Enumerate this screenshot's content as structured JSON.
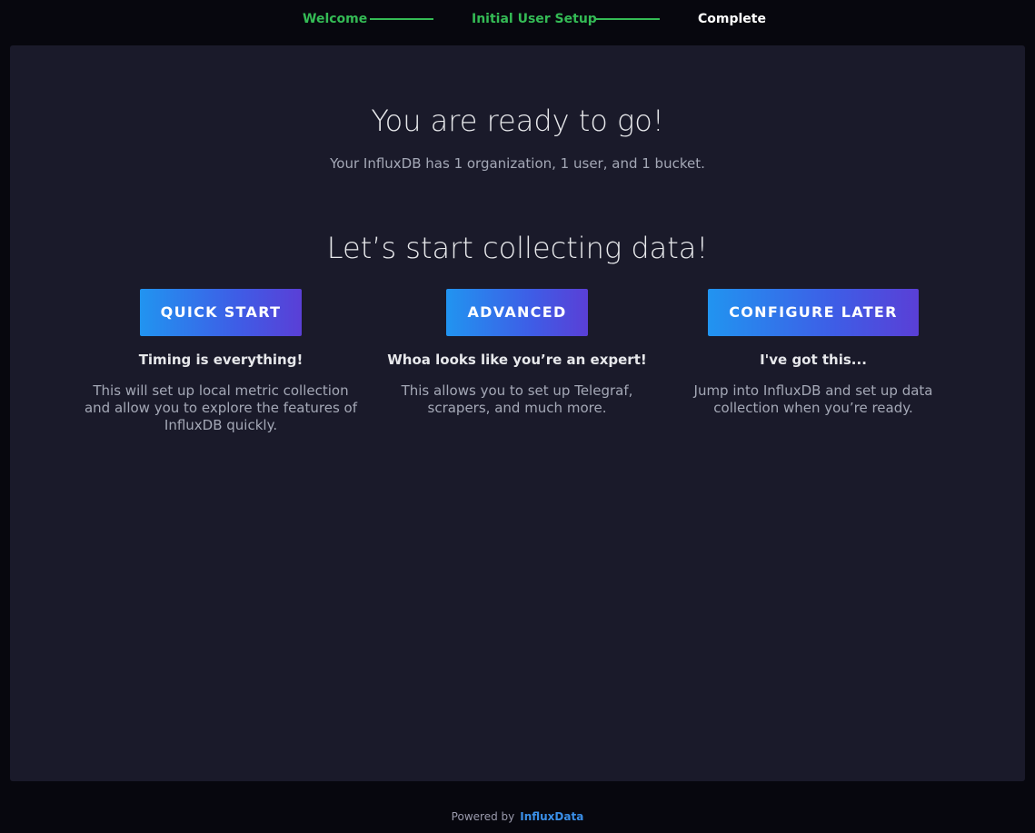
{
  "stepper": {
    "steps": [
      {
        "label": "Welcome",
        "status": "done"
      },
      {
        "label": "Initial User Setup",
        "status": "done"
      },
      {
        "label": "Complete",
        "status": "current"
      }
    ],
    "colors": {
      "done": "#34bb55",
      "current": "#ffffff"
    }
  },
  "main": {
    "title": "You are ready to go!",
    "subtitle": "Your InfluxDB has 1 organization, 1 user, and 1 bucket.",
    "collect_title": "Let’s start collecting data!",
    "options": [
      {
        "button_label": "QUICK START",
        "heading": "Timing is everything!",
        "description": "This will set up local metric collection and allow you to explore the features of InfluxDB quickly."
      },
      {
        "button_label": "ADVANCED",
        "heading": "Whoa looks like you’re an expert!",
        "description": "This allows you to set up Telegraf, scrapers, and much more."
      },
      {
        "button_label": "CONFIGURE LATER",
        "heading": "I've got this...",
        "description": "Jump into InfluxDB and set up data collection when you’re ready."
      }
    ]
  },
  "footer": {
    "powered_by": "Powered by",
    "brand": "InfluxData"
  },
  "theme": {
    "background": "#07070e",
    "panel": "#1a1a2a",
    "accent_gradient": [
      "#2194f0",
      "#5a3fd6"
    ],
    "link": "#3a8fe8"
  }
}
